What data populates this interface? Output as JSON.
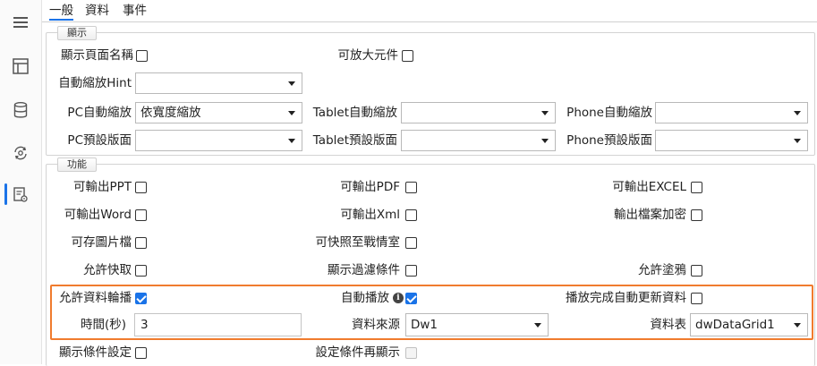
{
  "tabs": [
    {
      "label": "一般"
    },
    {
      "label": "資料"
    },
    {
      "label": "事件"
    }
  ],
  "display_group": {
    "legend": "顯示",
    "show_page_name": {
      "label": "顯示頁面名稱",
      "checked": false
    },
    "zoomable_element": {
      "label": "可放大元件",
      "checked": false
    },
    "auto_zoom_hint": {
      "label": "自動縮放Hint",
      "value": ""
    },
    "pc_auto_zoom": {
      "label": "PC自動縮放",
      "value": "依寬度縮放"
    },
    "tablet_auto_zoom": {
      "label": "Tablet自動縮放",
      "value": ""
    },
    "phone_auto_zoom": {
      "label": "Phone自動縮放",
      "value": ""
    },
    "pc_default_layout": {
      "label": "PC預設版面",
      "value": ""
    },
    "tablet_default_layout": {
      "label": "Tablet預設版面",
      "value": ""
    },
    "phone_default_layout": {
      "label": "Phone預設版面",
      "value": ""
    }
  },
  "function_group": {
    "legend": "功能",
    "export_ppt": {
      "label": "可輸出PPT",
      "checked": false
    },
    "export_pdf": {
      "label": "可輸出PDF",
      "checked": false
    },
    "export_excel": {
      "label": "可輸出EXCEL",
      "checked": false
    },
    "export_word": {
      "label": "可輸出Word",
      "checked": false
    },
    "export_xml": {
      "label": "可輸出Xml",
      "checked": false
    },
    "export_encrypt": {
      "label": "輸出檔案加密",
      "checked": false
    },
    "save_image": {
      "label": "可存圖片檔",
      "checked": false
    },
    "snapshot_to_war_room": {
      "label": "可快照至戰情室",
      "checked": false
    },
    "allow_cache": {
      "label": "允許快取",
      "checked": false
    },
    "show_filter_conditions": {
      "label": "顯示過濾條件",
      "checked": false
    },
    "allow_annotation": {
      "label": "允許塗鴉",
      "checked": false
    },
    "allow_data_carousel": {
      "label": "允許資料輪播",
      "checked": true
    },
    "auto_play": {
      "label": "自動播放",
      "checked": true
    },
    "refresh_after_play": {
      "label": "播放完成自動更新資料",
      "checked": false
    },
    "interval": {
      "label": "時間(秒)",
      "value": "3"
    },
    "data_source": {
      "label": "資料來源",
      "value": "Dw1"
    },
    "data_table": {
      "label": "資料表",
      "value": "dwDataGrid1"
    },
    "show_condition_settings": {
      "label": "顯示條件設定",
      "checked": false
    },
    "show_after_condition_set": {
      "label": "設定條件再顯示",
      "checked": false
    }
  },
  "colors": {
    "accent": "#1a73e8",
    "highlight_border": "#f07b2e"
  },
  "sidebar_icons": [
    "menu-icon",
    "layout-icon",
    "database-icon",
    "sync-settings-icon",
    "report-settings-icon"
  ]
}
